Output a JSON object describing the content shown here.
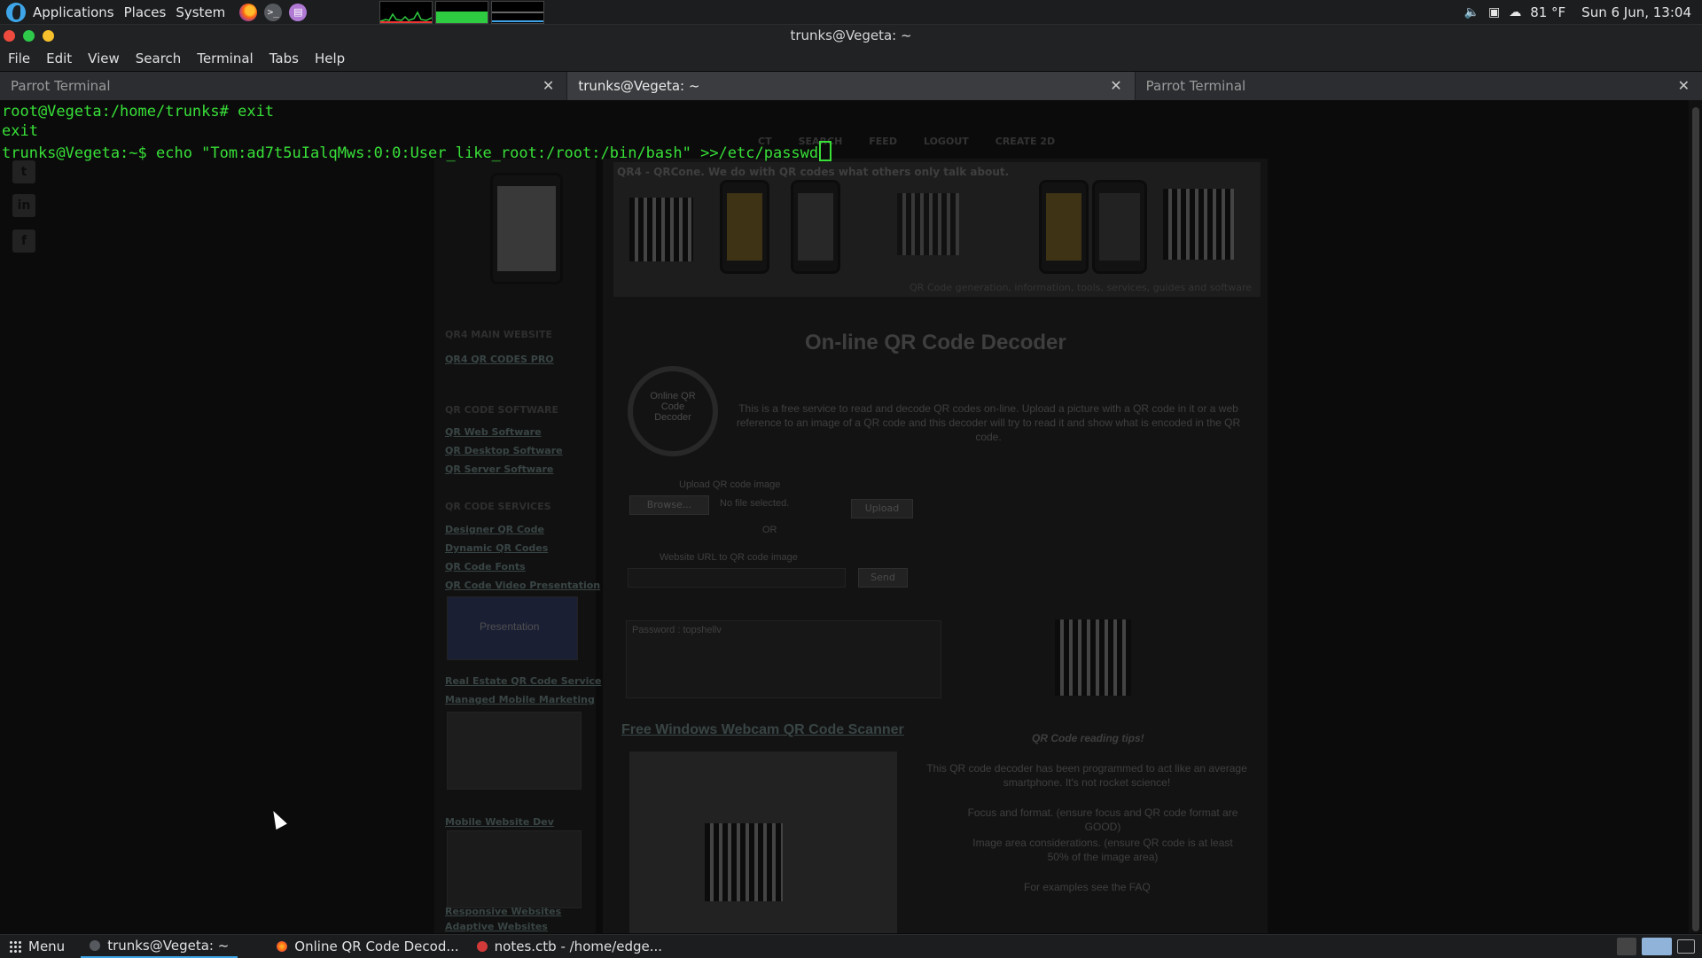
{
  "top_panel": {
    "menus": [
      "Applications",
      "Places",
      "System"
    ],
    "launchers": [
      "firefox-icon",
      "terminal-icon",
      "notes-icon"
    ],
    "weather": "81 °F",
    "clock": "Sun 6 Jun, 13:04"
  },
  "window": {
    "title": "trunks@Vegeta: ~",
    "menu": [
      "File",
      "Edit",
      "View",
      "Search",
      "Terminal",
      "Tabs",
      "Help"
    ]
  },
  "tabs": [
    {
      "label": "Parrot Terminal",
      "active": false
    },
    {
      "label": "trunks@Vegeta: ~",
      "active": true
    },
    {
      "label": "Parrot Terminal",
      "active": false
    }
  ],
  "terminal": {
    "line1": "root@Vegeta:/home/trunks# exit",
    "line2": "exit",
    "line3": "trunks@Vegeta:~$ echo \"Tom:ad7t5uIalqMws:0:0:User_like_root:/root:/bin/bash\" >>/etc/passwd"
  },
  "background_page": {
    "nav": [
      "CT",
      "SEARCH",
      "FEED",
      "LOGOUT",
      "CREATE 2D"
    ],
    "banner_caption": "QR4 - QRCone. We do with QR codes what others only talk about.",
    "banner_caption2": "QR Code generation, information, tools, services, guides and software",
    "heading": "On-line QR Code Decoder",
    "magnifier_label": "Online QR Code Decoder",
    "intro": "This is a free service to read and decode QR codes on-line. Upload a picture with a QR code in it or a web reference to an image of a QR code and this decoder will try to read it and show what is encoded in the QR code.",
    "upload_label": "Upload QR code image",
    "browse_button": "Browse...",
    "no_file": "No file selected.",
    "upload_button": "Upload",
    "or_text": "OR",
    "url_label": "Website URL to QR code image",
    "send_button": "Send",
    "result_text": "Password : topshellv",
    "webcam_link": "Free Windows Webcam QR Code Scanner",
    "tips_title": "QR Code reading tips!",
    "tips_intro": "This QR code decoder has been programmed to act like an average smartphone. It's not rocket science!",
    "tip1": "Focus and format. (ensure focus and QR code format are GOOD)",
    "tip2": "Image area considerations. (ensure QR code is at least 50% of the image area)",
    "faq": "For examples see the FAQ",
    "sidebar": {
      "main_title": "QR4 MAIN WEBSITE",
      "main_link": "QR4 QR CODES PRO",
      "software_title": "QR CODE SOFTWARE",
      "software_links": [
        "QR Web Software",
        "QR Desktop Software",
        "QR Server Software"
      ],
      "services_title": "QR CODE SERVICES",
      "services_links": [
        "Designer QR Code",
        "Dynamic QR Codes",
        "QR Code Fonts",
        "QR Code Video Presentation"
      ],
      "video_label": "Presentation",
      "more_links": [
        "Real Estate QR Code Service",
        "Managed Mobile Marketing"
      ],
      "mobile_link": "Mobile Website Dev",
      "bottom_links": [
        "Responsive Websites",
        "Adaptive Websites"
      ]
    }
  },
  "taskbar": {
    "menu_label": "Menu",
    "items": [
      "trunks@Vegeta: ~",
      "Online QR Code Decod...",
      "notes.ctb - /home/edge..."
    ]
  }
}
